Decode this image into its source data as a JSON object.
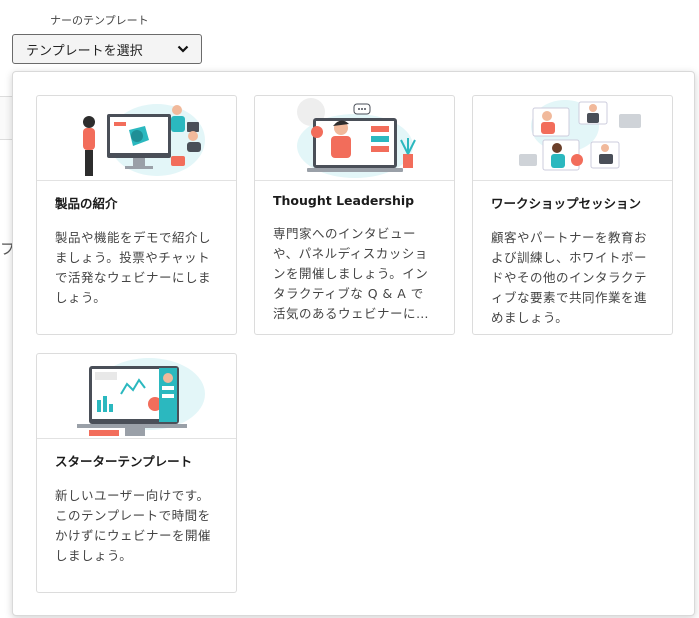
{
  "background": {
    "field_label": "ナーのテンプレート",
    "partial_glyph": "フ"
  },
  "select": {
    "label": "テンプレートを選択",
    "icon": "chevron-down-icon"
  },
  "templates": [
    {
      "title": "製品の紹介",
      "description": "製品や機能をデモで紹介しましょう。投票やチャットで活発なウェビナーにしましょう。"
    },
    {
      "title": "Thought Leadership",
      "description": "専門家へのインタビューや、パネルディスカッションを開催しましょう。インタラクティブな Q & A で活気のあるウェビナーにしましょう。"
    },
    {
      "title": "ワークショップセッション",
      "description": "顧客やパートナーを教育および訓練し、ホワイトボードやその他のインタラクティブな要素で共同作業を進めましょう。"
    },
    {
      "title": "スターターテンプレート",
      "description": "新しいユーザー向けです。このテンプレートで時間をかけずにウェビナーを開催しましょう。"
    }
  ],
  "colors": {
    "accent_teal": "#2bb8bf",
    "accent_coral": "#f26d5b",
    "light_teal": "#e3f6f8"
  }
}
